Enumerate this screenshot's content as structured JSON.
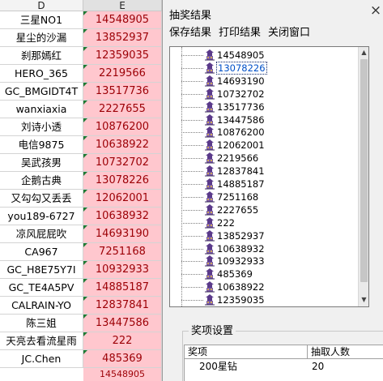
{
  "sheet": {
    "col_d": "D",
    "col_e": "E",
    "rows": [
      {
        "name": "三星NO1",
        "id": "14548905"
      },
      {
        "name": "星尘的沙漏",
        "id": "13852937"
      },
      {
        "name": "刹那嫣红",
        "id": "12359035"
      },
      {
        "name": "HERO_365",
        "id": "2219566"
      },
      {
        "name": "GC_BMGIDT4T",
        "id": "13517736"
      },
      {
        "name": "wanxiaxia",
        "id": "2227655"
      },
      {
        "name": "刘诗小透",
        "id": "10876200"
      },
      {
        "name": "电信9875",
        "id": "10638922"
      },
      {
        "name": "吴武孩男",
        "id": "10732702"
      },
      {
        "name": "企鹅古典",
        "id": "13078226"
      },
      {
        "name": "又勾勾又丢丢",
        "id": "12062001"
      },
      {
        "name": "you189-6727",
        "id": "10638932"
      },
      {
        "name": "凉风屁屁吹",
        "id": "14693190"
      },
      {
        "name": "CA967",
        "id": "7251168"
      },
      {
        "name": "GC_H8E75Y7I",
        "id": "10932933"
      },
      {
        "name": "GC_TE4A5PV",
        "id": "14885187"
      },
      {
        "name": "CALRAIN-YO",
        "id": "12837841"
      },
      {
        "name": "陈三姐",
        "id": "13447586"
      },
      {
        "name": "天亮去看流星雨",
        "id": "222"
      },
      {
        "name": "JC.Chen",
        "id": "485369"
      }
    ],
    "partial_value": "14548905"
  },
  "dialog": {
    "title": "抽奖结果",
    "close_glyph": "×",
    "menu": {
      "save": "保存结果",
      "print": "打印结果",
      "close": "关闭窗口"
    },
    "results": [
      "14548905",
      "13078226",
      "14693190",
      "10732702",
      "13517736",
      "13447586",
      "10876200",
      "12062001",
      "2219566",
      "12837841",
      "14885187",
      "7251168",
      "2227655",
      "222",
      "13852937",
      "10638932",
      "10932933",
      "485369",
      "10638922",
      "12359035"
    ],
    "selected_index": 1,
    "prize_group": {
      "legend": "奖项设置",
      "header_prize": "奖项",
      "header_count": "抽取人数",
      "rows": [
        {
          "prize": "200星钻",
          "count": "20"
        }
      ]
    }
  },
  "colors": {
    "cell_fill": "#ffc7ce",
    "cell_text": "#9c0006",
    "dialog_bg": "#f0f0f0"
  }
}
